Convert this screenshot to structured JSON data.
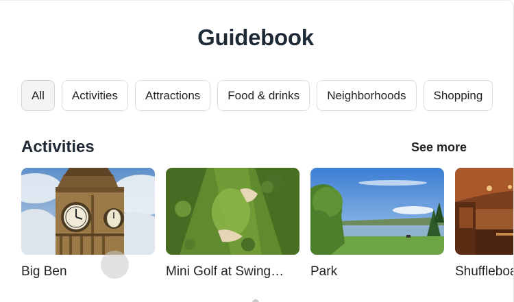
{
  "guidebook": {
    "title": "Guidebook"
  },
  "chips": [
    {
      "label": "All"
    },
    {
      "label": "Activities"
    },
    {
      "label": "Attractions"
    },
    {
      "label": "Food & drinks"
    },
    {
      "label": "Neighborhoods"
    },
    {
      "label": "Shopping"
    }
  ],
  "activities": {
    "title": "Activities",
    "see_more": "See more",
    "cards": [
      {
        "label": "Big Ben",
        "image": "big-ben-clock-tower"
      },
      {
        "label": "Mini Golf at Swing…",
        "image": "aerial-golf-course"
      },
      {
        "label": "Park",
        "image": "park-lake"
      },
      {
        "label": "Shuffleboard",
        "image": "wood-paneled-bar"
      }
    ]
  },
  "colors": {
    "title_text": "#1f2a37",
    "chip_border": "#dcdcdc",
    "chip_active_bg": "#f3f4f4"
  }
}
